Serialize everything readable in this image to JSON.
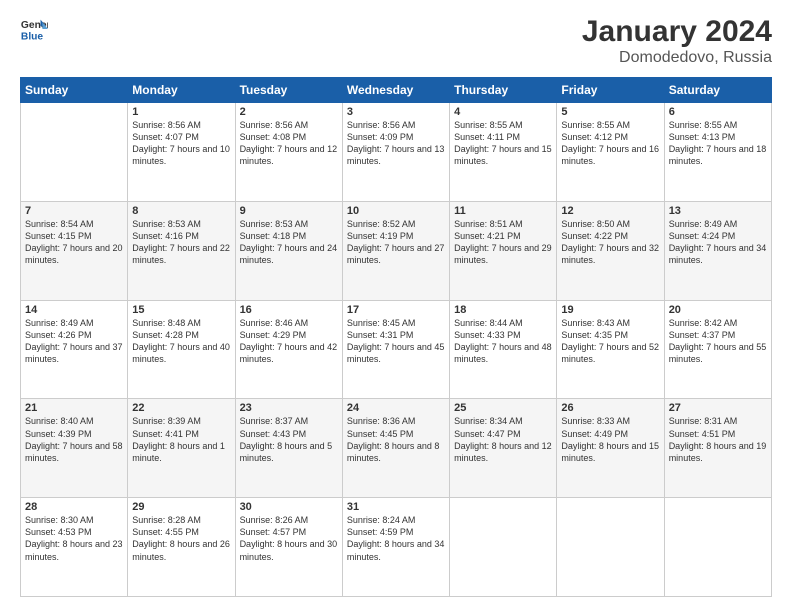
{
  "header": {
    "logo_line1": "General",
    "logo_line2": "Blue",
    "title": "January 2024",
    "subtitle": "Domodedovo, Russia"
  },
  "days_of_week": [
    "Sunday",
    "Monday",
    "Tuesday",
    "Wednesday",
    "Thursday",
    "Friday",
    "Saturday"
  ],
  "weeks": [
    [
      {
        "day": "",
        "sunrise": "",
        "sunset": "",
        "daylight": ""
      },
      {
        "day": "1",
        "sunrise": "8:56 AM",
        "sunset": "4:07 PM",
        "daylight": "7 hours and 10 minutes."
      },
      {
        "day": "2",
        "sunrise": "8:56 AM",
        "sunset": "4:08 PM",
        "daylight": "7 hours and 12 minutes."
      },
      {
        "day": "3",
        "sunrise": "8:56 AM",
        "sunset": "4:09 PM",
        "daylight": "7 hours and 13 minutes."
      },
      {
        "day": "4",
        "sunrise": "8:55 AM",
        "sunset": "4:11 PM",
        "daylight": "7 hours and 15 minutes."
      },
      {
        "day": "5",
        "sunrise": "8:55 AM",
        "sunset": "4:12 PM",
        "daylight": "7 hours and 16 minutes."
      },
      {
        "day": "6",
        "sunrise": "8:55 AM",
        "sunset": "4:13 PM",
        "daylight": "7 hours and 18 minutes."
      }
    ],
    [
      {
        "day": "7",
        "sunrise": "8:54 AM",
        "sunset": "4:15 PM",
        "daylight": "7 hours and 20 minutes."
      },
      {
        "day": "8",
        "sunrise": "8:53 AM",
        "sunset": "4:16 PM",
        "daylight": "7 hours and 22 minutes."
      },
      {
        "day": "9",
        "sunrise": "8:53 AM",
        "sunset": "4:18 PM",
        "daylight": "7 hours and 24 minutes."
      },
      {
        "day": "10",
        "sunrise": "8:52 AM",
        "sunset": "4:19 PM",
        "daylight": "7 hours and 27 minutes."
      },
      {
        "day": "11",
        "sunrise": "8:51 AM",
        "sunset": "4:21 PM",
        "daylight": "7 hours and 29 minutes."
      },
      {
        "day": "12",
        "sunrise": "8:50 AM",
        "sunset": "4:22 PM",
        "daylight": "7 hours and 32 minutes."
      },
      {
        "day": "13",
        "sunrise": "8:49 AM",
        "sunset": "4:24 PM",
        "daylight": "7 hours and 34 minutes."
      }
    ],
    [
      {
        "day": "14",
        "sunrise": "8:49 AM",
        "sunset": "4:26 PM",
        "daylight": "7 hours and 37 minutes."
      },
      {
        "day": "15",
        "sunrise": "8:48 AM",
        "sunset": "4:28 PM",
        "daylight": "7 hours and 40 minutes."
      },
      {
        "day": "16",
        "sunrise": "8:46 AM",
        "sunset": "4:29 PM",
        "daylight": "7 hours and 42 minutes."
      },
      {
        "day": "17",
        "sunrise": "8:45 AM",
        "sunset": "4:31 PM",
        "daylight": "7 hours and 45 minutes."
      },
      {
        "day": "18",
        "sunrise": "8:44 AM",
        "sunset": "4:33 PM",
        "daylight": "7 hours and 48 minutes."
      },
      {
        "day": "19",
        "sunrise": "8:43 AM",
        "sunset": "4:35 PM",
        "daylight": "7 hours and 52 minutes."
      },
      {
        "day": "20",
        "sunrise": "8:42 AM",
        "sunset": "4:37 PM",
        "daylight": "7 hours and 55 minutes."
      }
    ],
    [
      {
        "day": "21",
        "sunrise": "8:40 AM",
        "sunset": "4:39 PM",
        "daylight": "7 hours and 58 minutes."
      },
      {
        "day": "22",
        "sunrise": "8:39 AM",
        "sunset": "4:41 PM",
        "daylight": "8 hours and 1 minute."
      },
      {
        "day": "23",
        "sunrise": "8:37 AM",
        "sunset": "4:43 PM",
        "daylight": "8 hours and 5 minutes."
      },
      {
        "day": "24",
        "sunrise": "8:36 AM",
        "sunset": "4:45 PM",
        "daylight": "8 hours and 8 minutes."
      },
      {
        "day": "25",
        "sunrise": "8:34 AM",
        "sunset": "4:47 PM",
        "daylight": "8 hours and 12 minutes."
      },
      {
        "day": "26",
        "sunrise": "8:33 AM",
        "sunset": "4:49 PM",
        "daylight": "8 hours and 15 minutes."
      },
      {
        "day": "27",
        "sunrise": "8:31 AM",
        "sunset": "4:51 PM",
        "daylight": "8 hours and 19 minutes."
      }
    ],
    [
      {
        "day": "28",
        "sunrise": "8:30 AM",
        "sunset": "4:53 PM",
        "daylight": "8 hours and 23 minutes."
      },
      {
        "day": "29",
        "sunrise": "8:28 AM",
        "sunset": "4:55 PM",
        "daylight": "8 hours and 26 minutes."
      },
      {
        "day": "30",
        "sunrise": "8:26 AM",
        "sunset": "4:57 PM",
        "daylight": "8 hours and 30 minutes."
      },
      {
        "day": "31",
        "sunrise": "8:24 AM",
        "sunset": "4:59 PM",
        "daylight": "8 hours and 34 minutes."
      },
      {
        "day": "",
        "sunrise": "",
        "sunset": "",
        "daylight": ""
      },
      {
        "day": "",
        "sunrise": "",
        "sunset": "",
        "daylight": ""
      },
      {
        "day": "",
        "sunrise": "",
        "sunset": "",
        "daylight": ""
      }
    ]
  ],
  "labels": {
    "sunrise_prefix": "Sunrise: ",
    "sunset_prefix": "Sunset: ",
    "daylight_prefix": "Daylight: "
  }
}
